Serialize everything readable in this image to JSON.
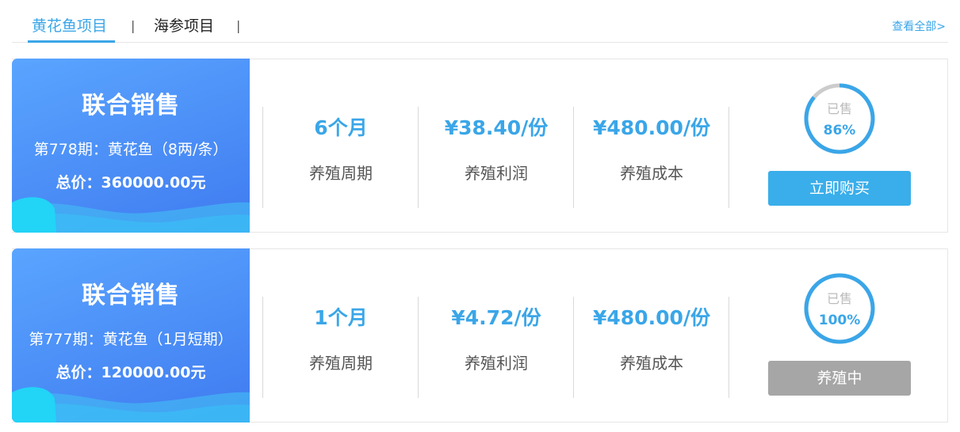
{
  "tabs": [
    {
      "label": "黄花鱼项目"
    },
    {
      "label": "海参项目"
    }
  ],
  "tab_separator": "|",
  "view_all": "查看全部>",
  "colors": {
    "accent": "#3aa6e8",
    "banner": "#4a8cf6",
    "buy_button": "#3aaeea",
    "disabled_button": "#a6a6a6",
    "ring_track": "#cccccc"
  },
  "projects": [
    {
      "title": "联合销售",
      "period": "第778期：黄花鱼（8两/条）",
      "total": "总价：360000.00元",
      "stats": [
        {
          "value": "6个月",
          "label": "养殖周期"
        },
        {
          "value": "¥38.40/份",
          "label": "养殖利润"
        },
        {
          "value": "¥480.00/份",
          "label": "养殖成本"
        }
      ],
      "sold_label": "已售",
      "sold_percent": 86,
      "sold_text": "86%",
      "button": "立即购买"
    },
    {
      "title": "联合销售",
      "period": "第777期：黄花鱼（1月短期）",
      "total": "总价：120000.00元",
      "stats": [
        {
          "value": "1个月",
          "label": "养殖周期"
        },
        {
          "value": "¥4.72/份",
          "label": "养殖利润"
        },
        {
          "value": "¥480.00/份",
          "label": "养殖成本"
        }
      ],
      "sold_label": "已售",
      "sold_percent": 100,
      "sold_text": "100%",
      "button": "养殖中"
    }
  ]
}
